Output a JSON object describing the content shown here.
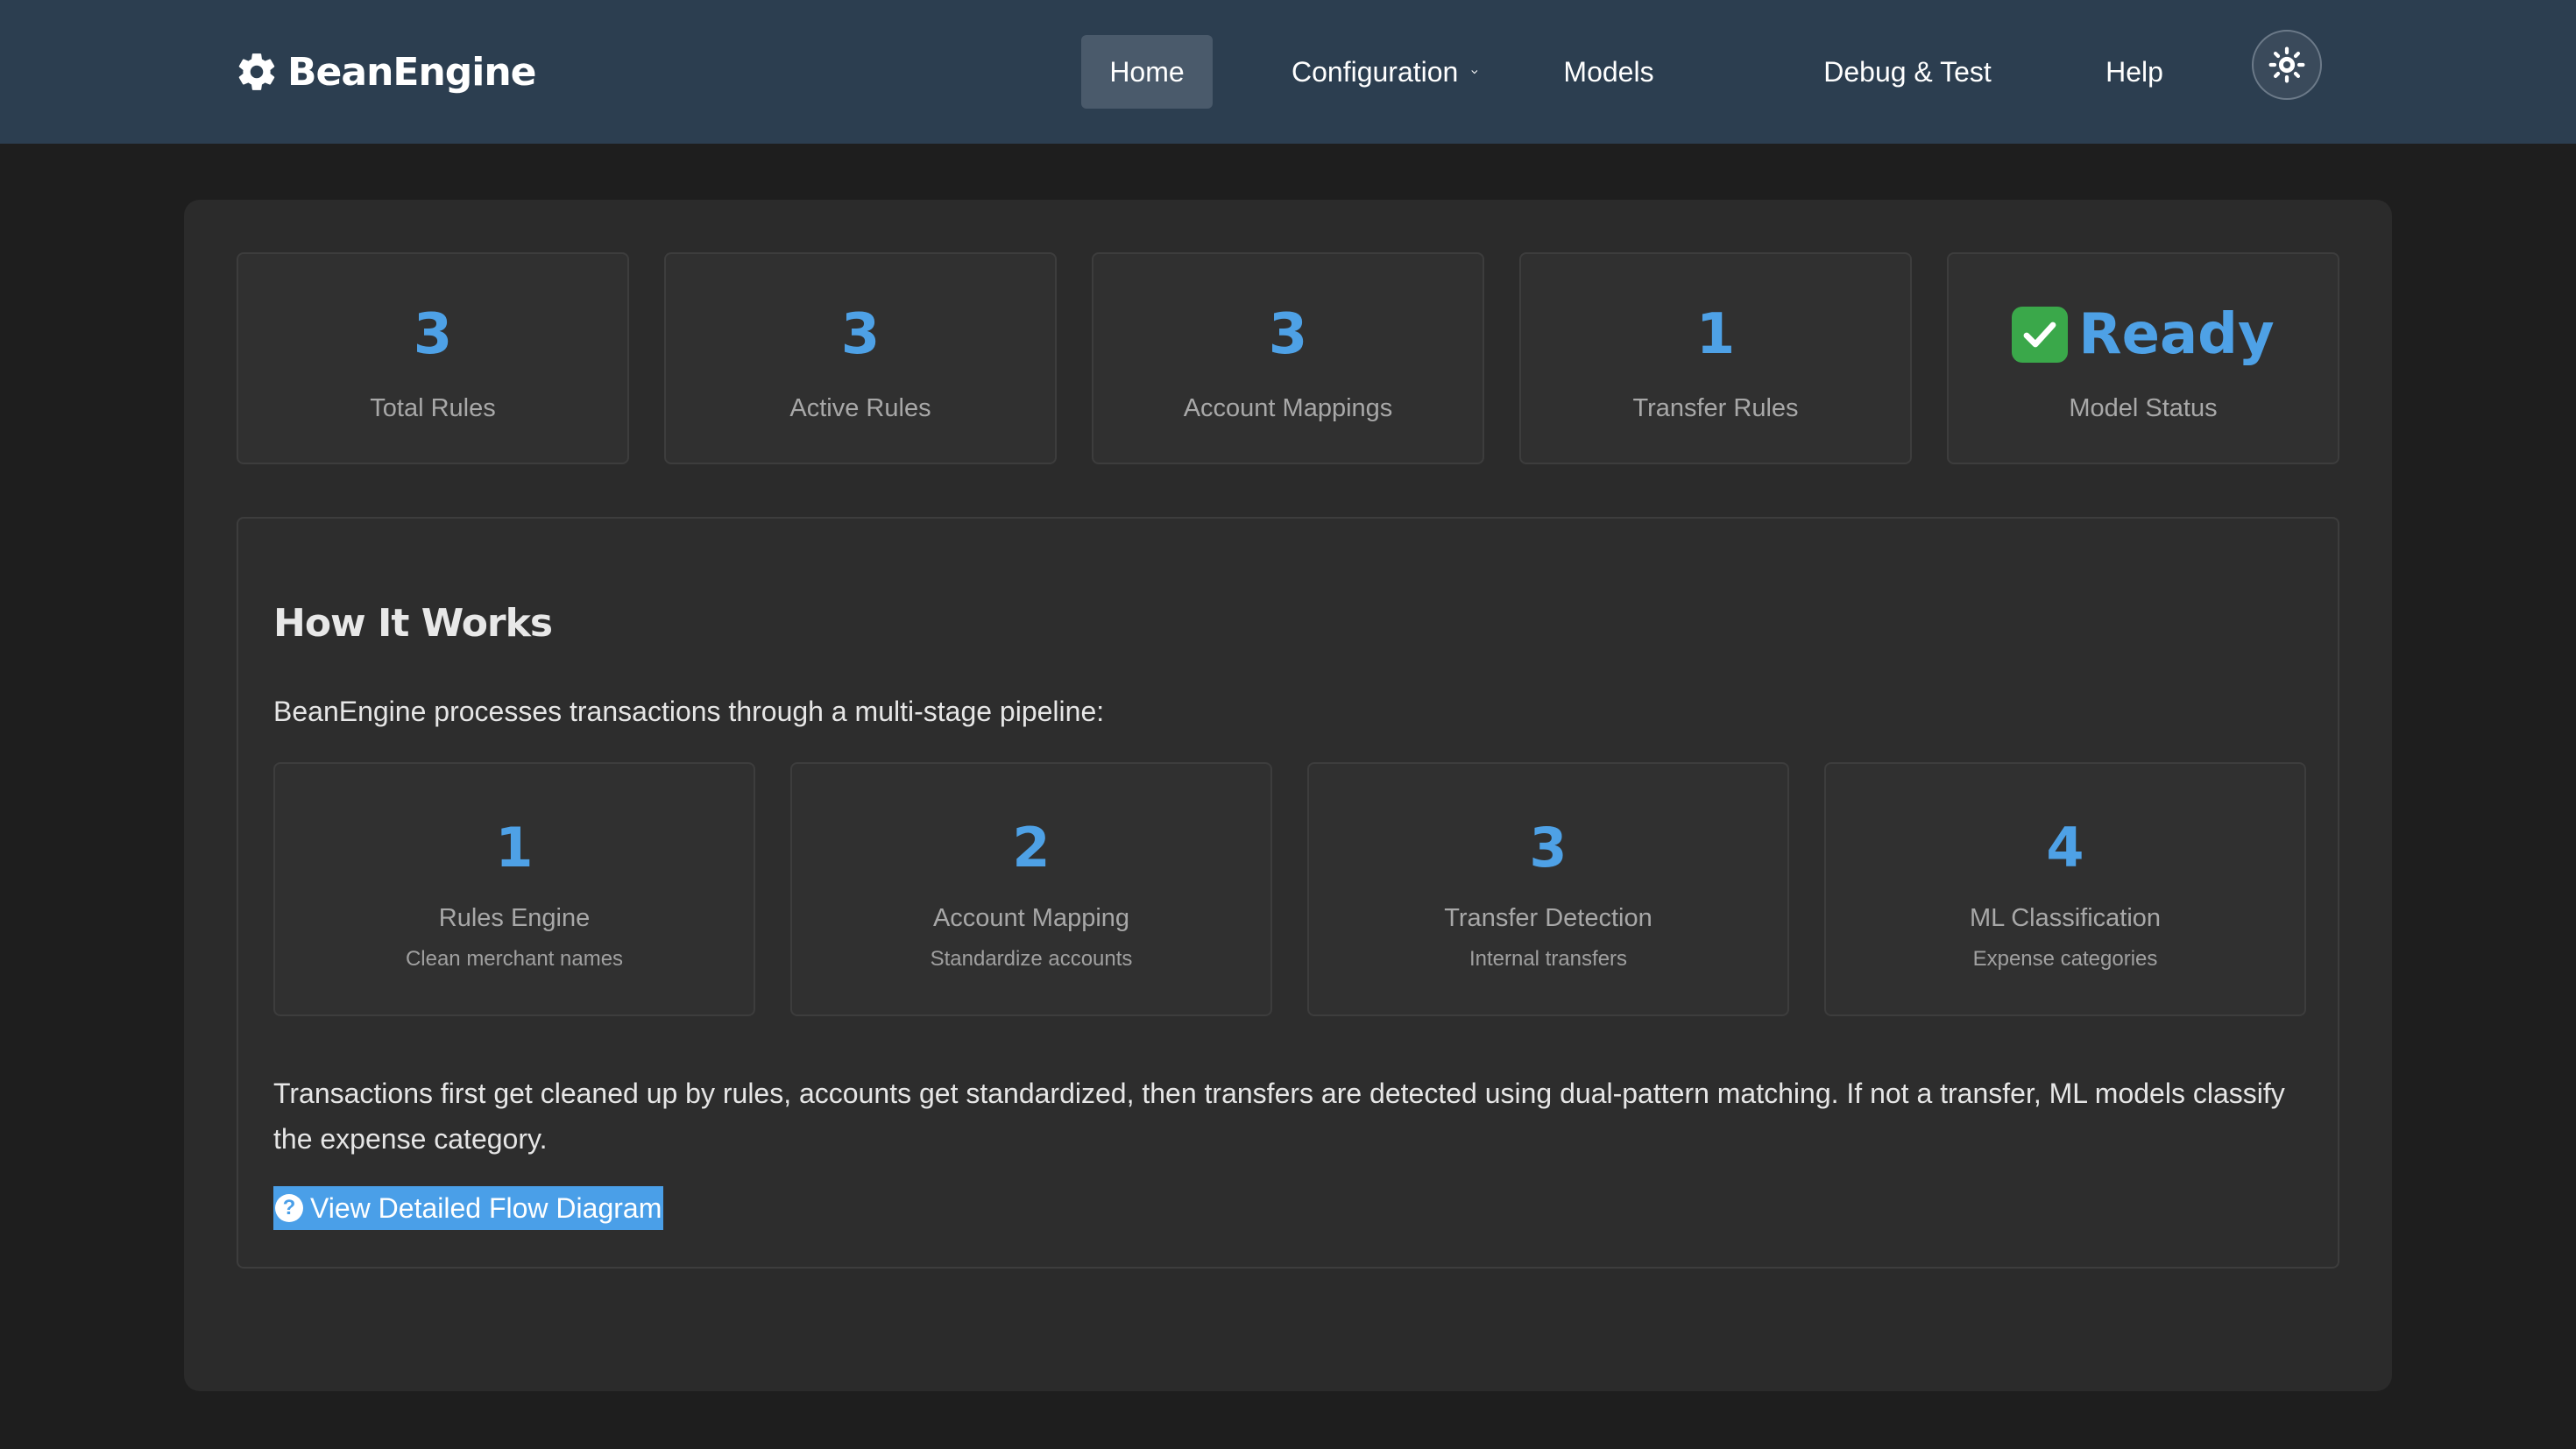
{
  "brand": {
    "name": "BeanEngine",
    "icon": "gear-icon"
  },
  "nav": {
    "items": [
      {
        "label": "Home",
        "active": true
      },
      {
        "label": "Configuration",
        "dropdown": true
      },
      {
        "label": "Models"
      },
      {
        "label": "Debug & Test"
      },
      {
        "label": "Help"
      }
    ],
    "theme_toggle_icon": "sun-icon"
  },
  "stats": [
    {
      "value": "3",
      "label": "Total Rules"
    },
    {
      "value": "3",
      "label": "Active Rules"
    },
    {
      "value": "3",
      "label": "Account Mappings"
    },
    {
      "value": "1",
      "label": "Transfer Rules"
    },
    {
      "value": "Ready",
      "label": "Model Status",
      "icon": "check-mark-icon"
    }
  ],
  "how_it_works": {
    "title": "How It Works",
    "intro": "BeanEngine processes transactions through a multi-stage pipeline:",
    "steps": [
      {
        "number": "1",
        "title": "Rules Engine",
        "subtitle": "Clean merchant names"
      },
      {
        "number": "2",
        "title": "Account Mapping",
        "subtitle": "Standardize accounts"
      },
      {
        "number": "3",
        "title": "Transfer Detection",
        "subtitle": "Internal transfers"
      },
      {
        "number": "4",
        "title": "ML Classification",
        "subtitle": "Expense categories"
      }
    ],
    "description": "Transactions first get cleaned up by rules, accounts get standardized, then transfers are detected using dual-pattern matching. If not a transfer, ML models classify the expense category.",
    "link": {
      "icon": "question-circle-icon",
      "label": "View Detailed Flow Diagram"
    }
  },
  "colors": {
    "navbar": "#2c3e50",
    "accent": "#4ea1e6",
    "panel": "#2b2b2b",
    "page_bg": "#1e1e1e",
    "status_green": "#3aa84a"
  }
}
